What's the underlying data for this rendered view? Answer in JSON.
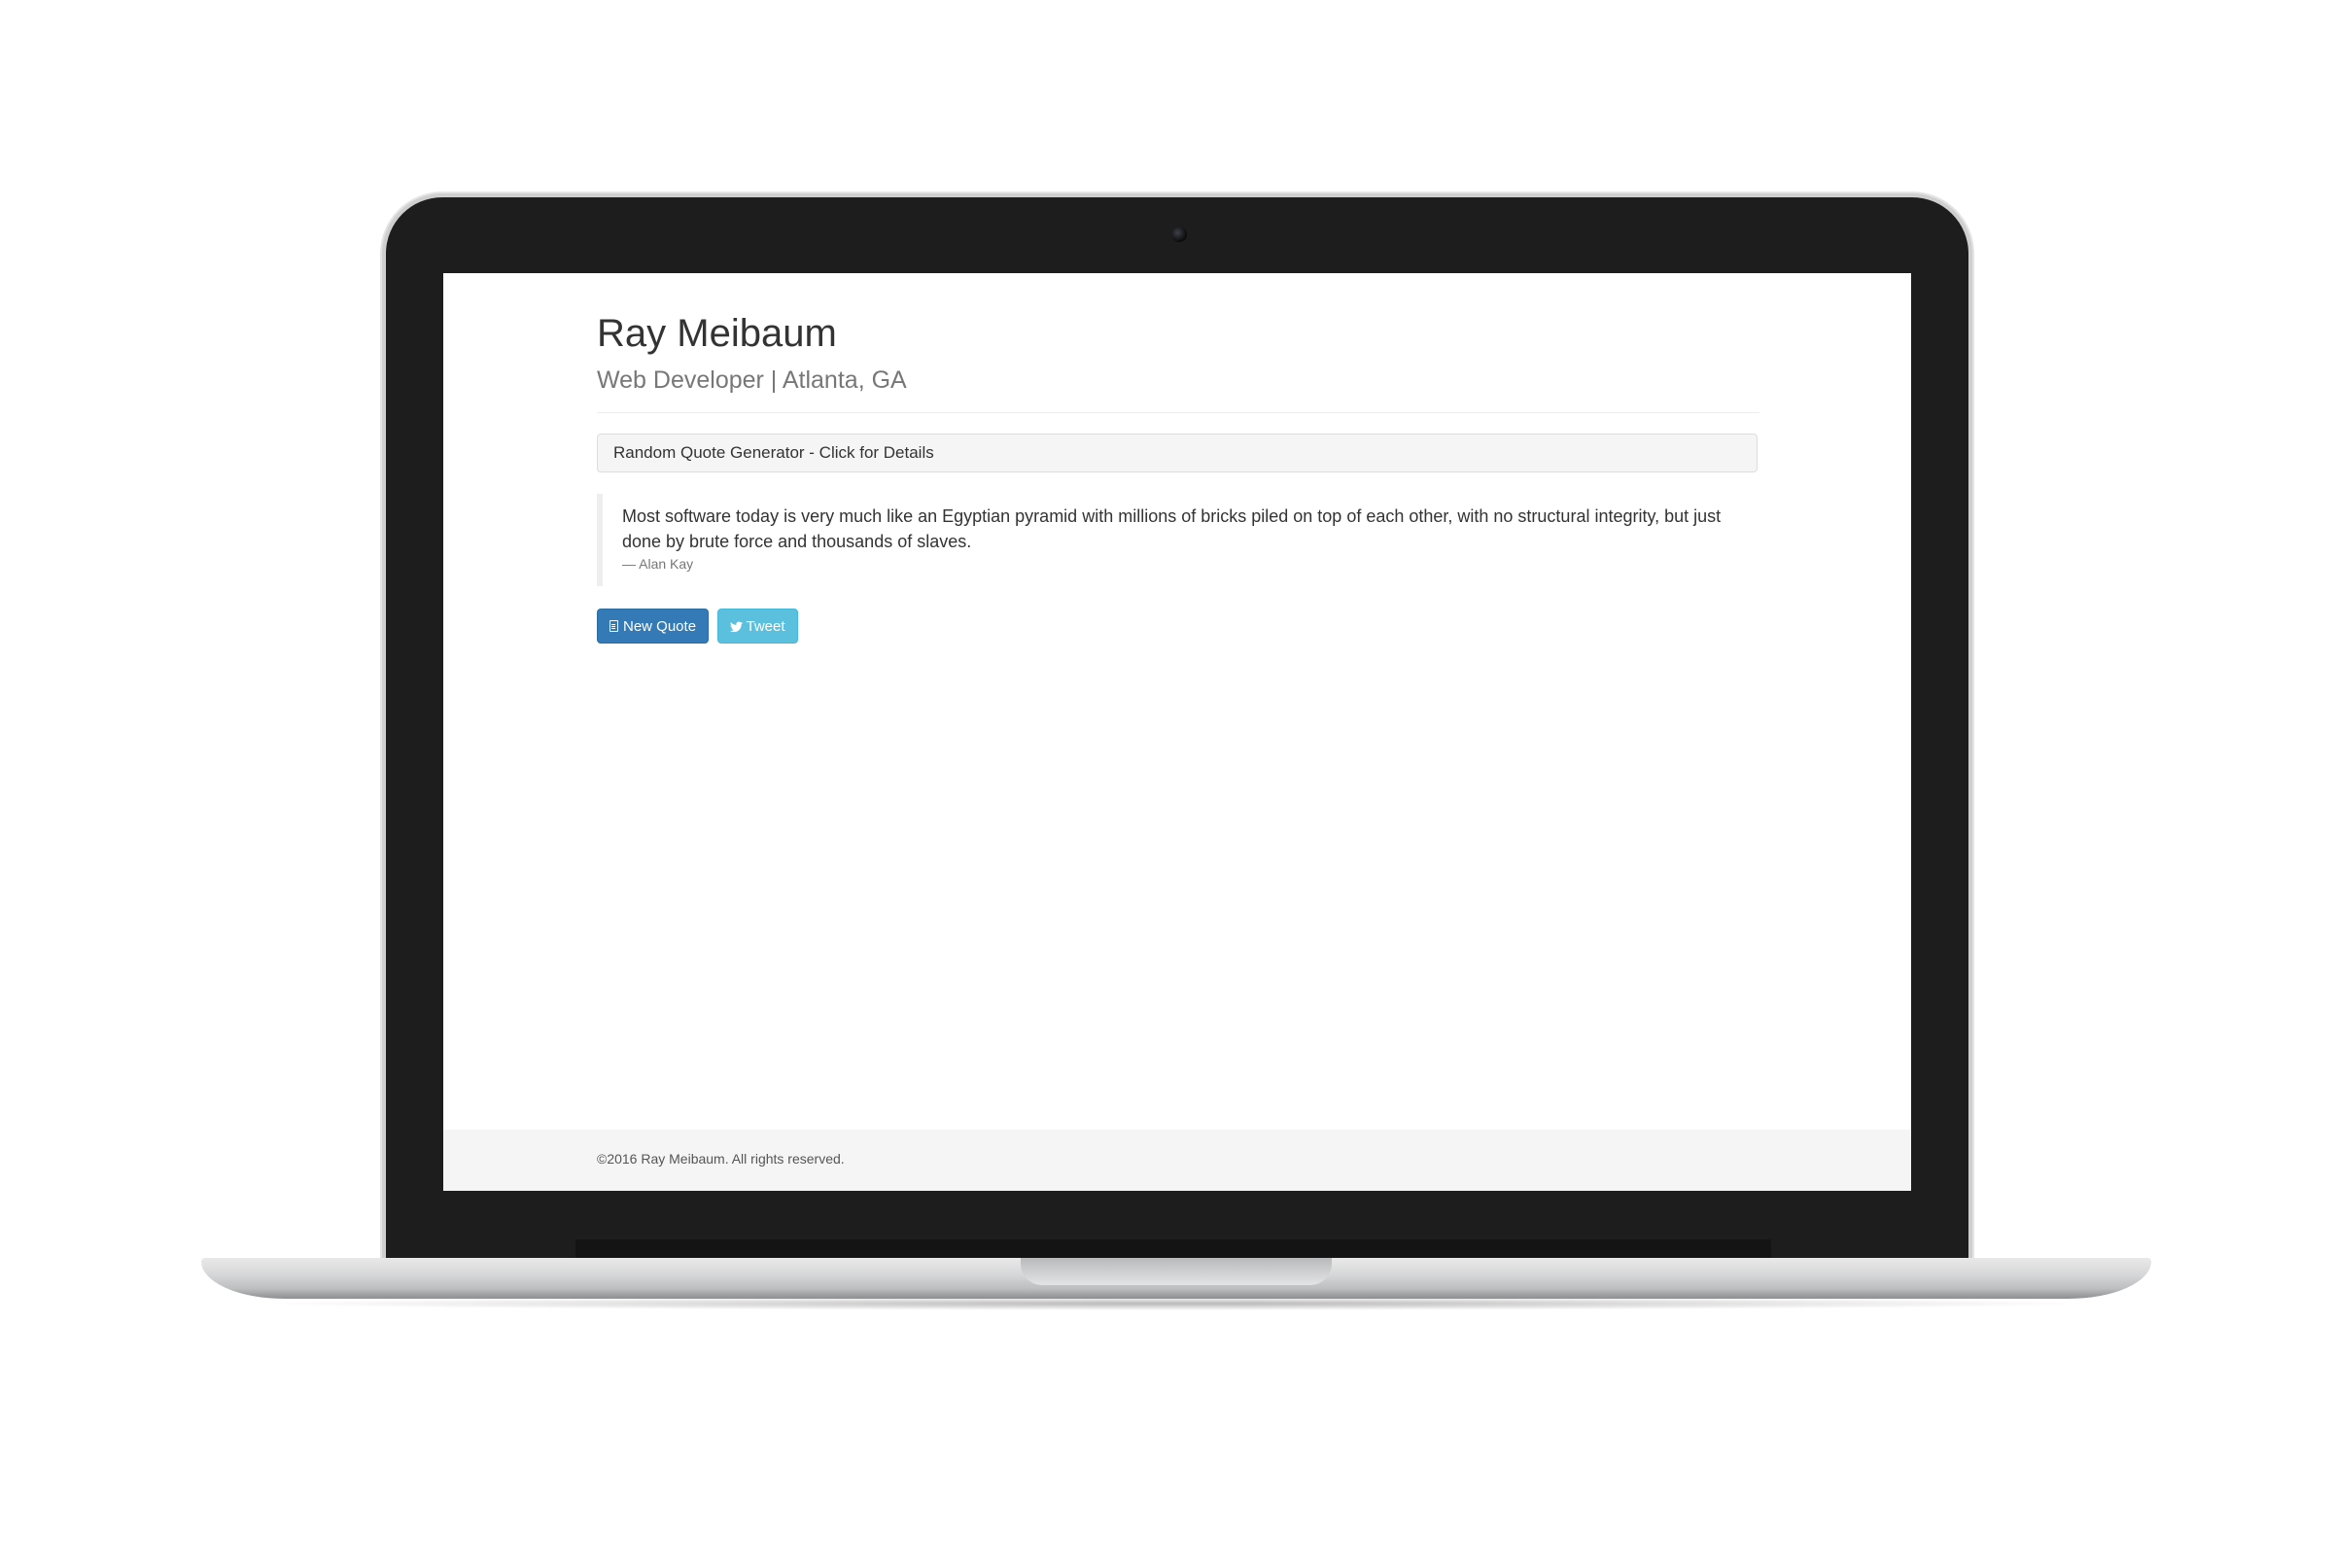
{
  "header": {
    "name": "Ray Meibaum",
    "tagline": "Web Developer | Atlanta, GA"
  },
  "panel": {
    "heading": "Random Quote Generator - Click for Details"
  },
  "quote": {
    "text": "Most software today is very much like an Egyptian pyramid with millions of bricks piled on top of each other, with no structural integrity, but just done by brute force and thousands of slaves.",
    "author": "— Alan Kay"
  },
  "buttons": {
    "new_quote": "New Quote",
    "new_quote_icon": "document-icon",
    "tweet": "Tweet",
    "tweet_icon": "twitter-bird-icon"
  },
  "footer": {
    "copyright": "©2016 Ray Meibaum. All rights reserved."
  },
  "colors": {
    "primary": "#337ab7",
    "info": "#5bc0de",
    "panel_bg": "#f5f5f5",
    "footer_bg": "#f5f5f5"
  }
}
